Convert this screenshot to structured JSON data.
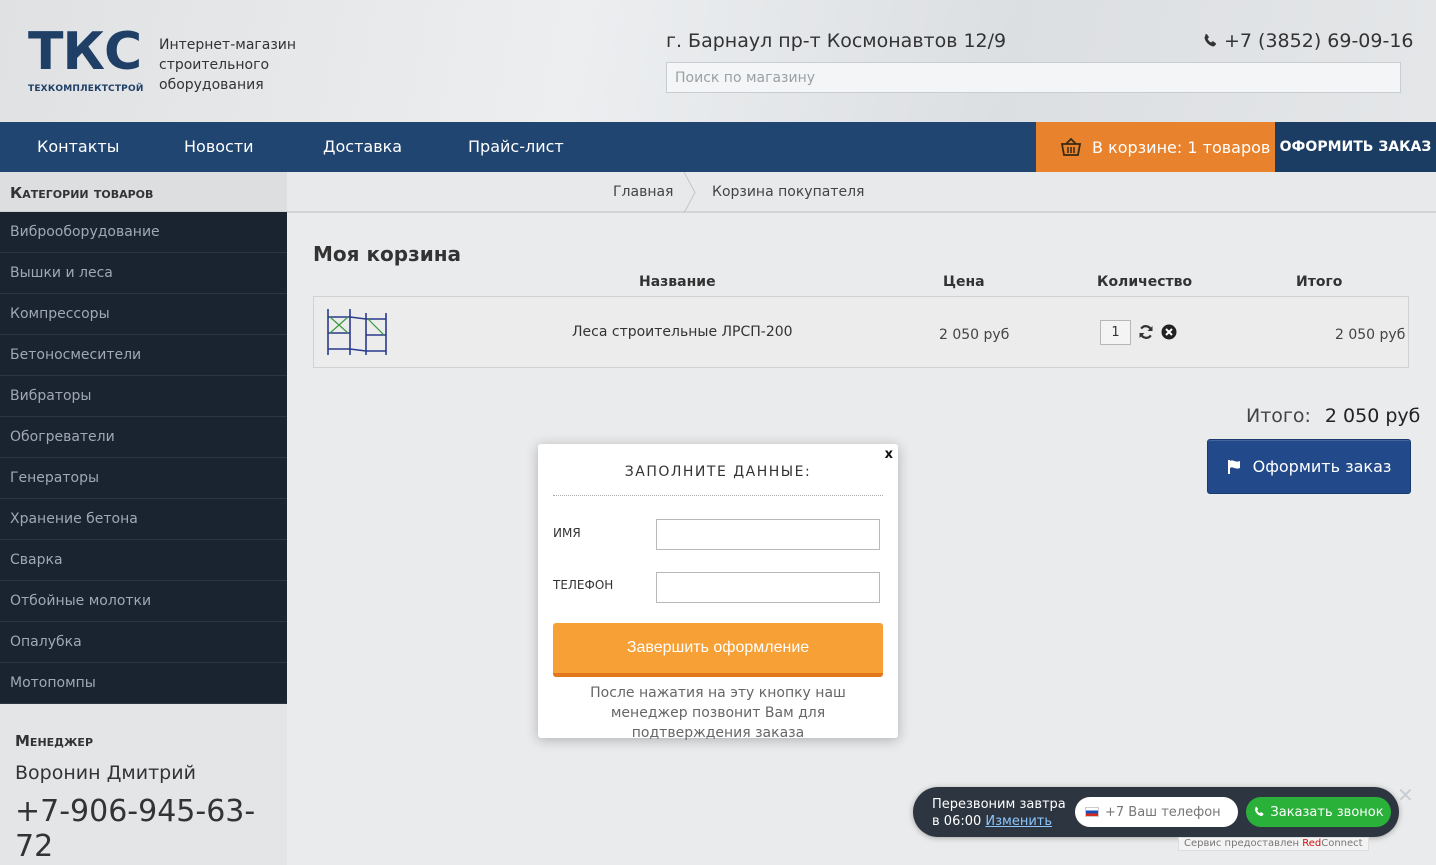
{
  "header": {
    "logo_text": "ТКС",
    "logo_subtext": "ТЕХКОМПЛЕКТСТРОЙ",
    "tagline": "Интернет-магазин\nстроительного\nоборудования",
    "address": "г. Барнаул пр-т Космонавтов 12/9",
    "phone": "+7 (3852) 69-09-16",
    "search_placeholder": "Поиск по магазину"
  },
  "nav": {
    "items": [
      "Контакты",
      "Новости",
      "Доставка",
      "Прайс-лист"
    ],
    "cart_label": "В корзине: 1 товаров",
    "checkout_label": "ОФОРМИТЬ ЗАКАЗ"
  },
  "sidebar": {
    "title": "Категории товаров",
    "categories": [
      "Виброоборудование",
      "Вышки и леса",
      "Компрессоры",
      "Бетоносмесители",
      "Вибраторы",
      "Обогреватели",
      "Генераторы",
      "Хранение бетона",
      "Сварка",
      "Отбойные молотки",
      "Опалубка",
      "Мотопомпы"
    ],
    "manager_title": "Менеджер",
    "manager_name": "Воронин Дмитрий",
    "manager_phone": "+7-906-945-63-72"
  },
  "breadcrumb": {
    "home": "Главная",
    "current": "Корзина покупателя"
  },
  "cart": {
    "title": "Моя корзина",
    "columns": {
      "name": "Название",
      "price": "Цена",
      "quantity": "Количество",
      "total": "Итого"
    },
    "items": [
      {
        "name": "Леса строительные ЛРСП-200",
        "price": "2 050 руб",
        "quantity": "1",
        "total": "2 050 руб"
      }
    ],
    "total_label": "Итого:",
    "total_value": "2 050 руб",
    "checkout_button": "Оформить заказ"
  },
  "modal": {
    "close": "x",
    "title": "ЗАПОЛНИТЕ ДАННЫЕ:",
    "name_label": "ИМЯ",
    "phone_label": "ТЕЛЕФОН",
    "submit_label": "Завершить оформление",
    "note": "После нажатия на эту кнопку наш менеджер позвонит Вам для подтверждения заказа"
  },
  "callback": {
    "text_line1": "Перезвоним завтра",
    "text_line2": "в 06:00",
    "change_link": "Изменить",
    "phone_placeholder": "+7 Ваш телефон",
    "button_label": "Заказать звонок",
    "close": "✕",
    "credit_prefix": "Сервис предоставлен ",
    "credit_brand_red": "Red",
    "credit_brand_rest": "Connect"
  },
  "colors": {
    "nav_bg": "#1f4570",
    "cart_orange": "#e8822c",
    "sidebar_dark": "#1a2430",
    "checkout_blue": "#224a8a",
    "submit_orange": "#f7a035",
    "callback_green": "#2ab13a"
  }
}
